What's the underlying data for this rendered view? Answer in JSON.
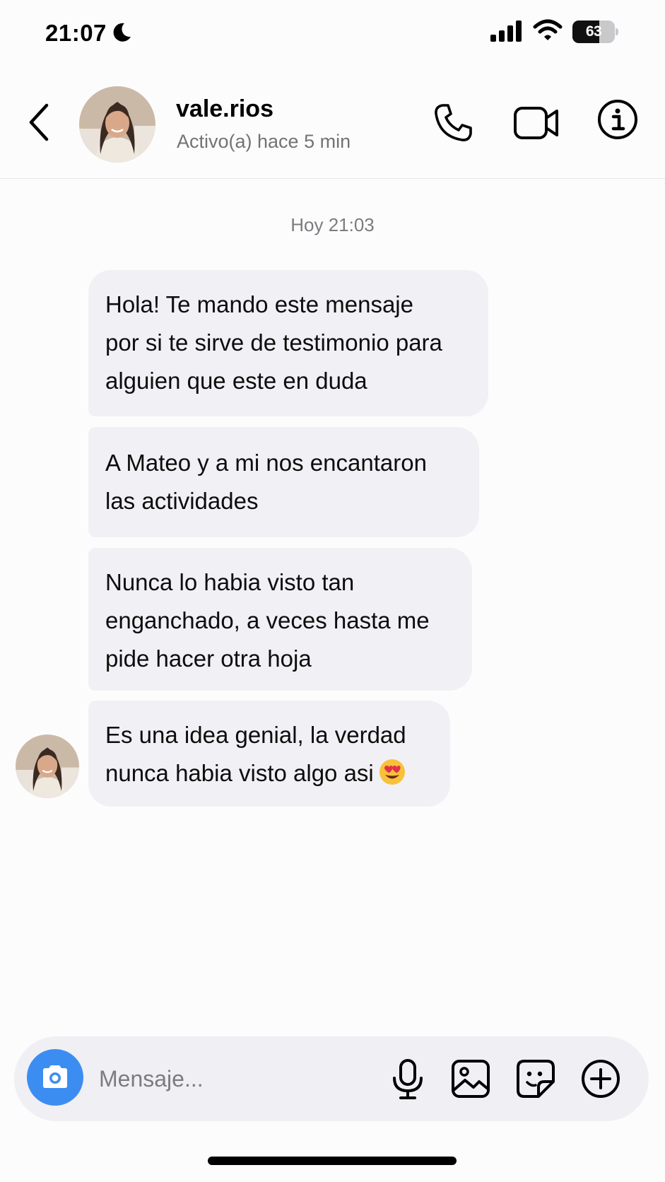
{
  "status_bar": {
    "time": "21:07",
    "battery_percent": 63,
    "battery_label": "63",
    "icons": [
      "moon-icon",
      "cellular-signal-icon",
      "wifi-icon",
      "battery-icon"
    ]
  },
  "header": {
    "username": "vale.rios",
    "active_status": "Activo(a) hace 5 min",
    "icons": [
      "chevron-left-icon",
      "phone-icon",
      "video-camera-icon",
      "info-icon"
    ]
  },
  "conversation": {
    "timestamp": "Hoy 21:03",
    "messages": [
      {
        "lines": [
          "Hola! Te mando este mensaje",
          "por si te sirve de testimonio para",
          "alguien que este en duda"
        ]
      },
      {
        "lines": [
          "A Mateo y a mi nos encantaron",
          "las actividades"
        ]
      },
      {
        "lines": [
          "Nunca lo habia visto tan",
          "enganchado, a veces hasta me",
          "pide hacer otra hoja"
        ]
      },
      {
        "lines": [
          "Es una idea genial, la verdad",
          "nunca habia visto algo asi"
        ],
        "emoji": "heart-eyes-emoji"
      }
    ]
  },
  "composer": {
    "placeholder": "Mensaje...",
    "accent_color": "#3c8df2",
    "icons": [
      "camera-icon",
      "microphone-icon",
      "image-gallery-icon",
      "sticker-icon",
      "plus-circle-icon"
    ]
  }
}
